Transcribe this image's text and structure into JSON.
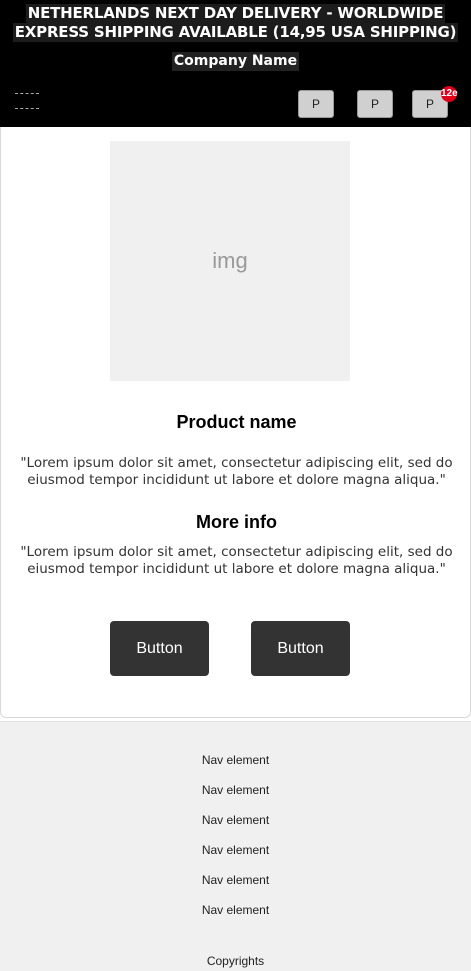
{
  "header": {
    "banner_line1": "NETHERLANDS NEXT DAY DELIVERY - WORLDWIDE",
    "banner_line2": "EXPRESS SHIPPING AVAILABLE (14,95 USA SHIPPING)",
    "company_name": "Company Name",
    "buttons": [
      "P",
      "P",
      "P"
    ],
    "cart_badge": "12e"
  },
  "product": {
    "image_label": "img",
    "name": "Product name",
    "description_line1": "\"Lorem ipsum dolor sit amet, consectetur adipiscing elit, sed do",
    "description_line2": "eiusmod tempor incididunt ut labore et dolore magna aliqua.\"",
    "more_info_title": "More info",
    "more_info_line1": "\"Lorem ipsum dolor sit amet, consectetur adipiscing elit, sed do",
    "more_info_line2": "eiusmod tempor incididunt ut labore et dolore magna aliqua.\"",
    "button1": "Button",
    "button2": "Button"
  },
  "footer": {
    "nav": [
      "Nav element",
      "Nav element",
      "Nav element",
      "Nav element",
      "Nav element",
      "Nav element"
    ],
    "copyright": "Copyrights"
  }
}
